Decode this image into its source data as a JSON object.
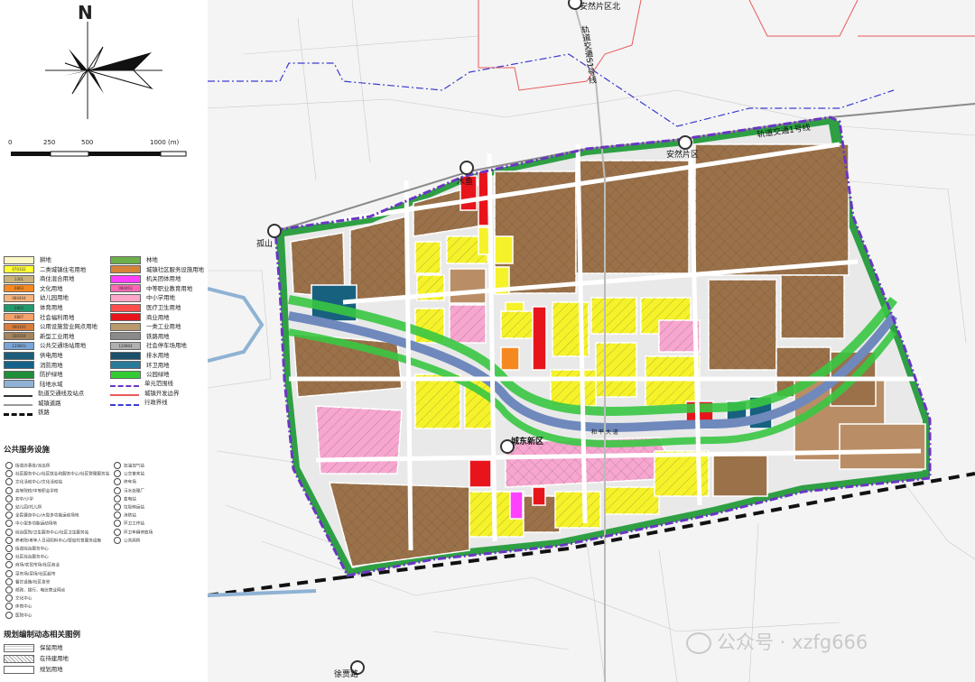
{
  "north": "N",
  "scale_labels": [
    "0",
    "250",
    "500",
    "1000",
    "(m)"
  ],
  "land_use_legend_left": [
    {
      "label": "耕地",
      "color": "#fbf8c6",
      "code": ""
    },
    {
      "label": "二类城镇住宅用地",
      "color": "#ffff33",
      "code": "070102"
    },
    {
      "label": "商住混合用地",
      "color": "#c8b27a",
      "code": "1301"
    },
    {
      "label": "文化用地",
      "color": "#f5891f",
      "code": "0803"
    },
    {
      "label": "幼儿园用地",
      "color": "#f4b37c",
      "code": "080404"
    },
    {
      "label": "体育用地",
      "color": "#1f9a6a",
      "code": "0805"
    },
    {
      "label": "社会福利用地",
      "color": "#f4a16a",
      "code": "0807"
    },
    {
      "label": "公用设施营业网点用地",
      "color": "#d97c3a",
      "code": "090105"
    },
    {
      "label": "新型工业用地",
      "color": "#a4845c",
      "code": "100104"
    },
    {
      "label": "公共交通场站用地",
      "color": "#7aa5d8",
      "code": "120803"
    },
    {
      "label": "供电用地",
      "color": "#1b5e7a",
      "code": ""
    },
    {
      "label": "消防用地",
      "color": "#14628a",
      "code": ""
    },
    {
      "label": "防护绿地",
      "color": "#1f8f3a",
      "code": ""
    },
    {
      "label": "陆地水域",
      "color": "#8fb2d4",
      "code": ""
    }
  ],
  "land_use_legend_right": [
    {
      "label": "林地",
      "color": "#6cb04a",
      "code": ""
    },
    {
      "label": "城镇社区服务设施用地",
      "color": "#d4843a",
      "code": ""
    },
    {
      "label": "机关团体用地",
      "color": "#ff40ff",
      "code": ""
    },
    {
      "label": "中等职业教育用地",
      "color": "#ff69b4",
      "code": "080403"
    },
    {
      "label": "中小学用地",
      "color": "#ffa6c9",
      "code": ""
    },
    {
      "label": "医疗卫生用地",
      "color": "#ff4d4d",
      "code": ""
    },
    {
      "label": "商业用地",
      "color": "#e8141c",
      "code": ""
    },
    {
      "label": "一类工业用地",
      "color": "#b89a6c",
      "code": ""
    },
    {
      "label": "铁路用地",
      "color": "#8a8a8a",
      "code": ""
    },
    {
      "label": "社会停车场用地",
      "color": "#b0b0b0",
      "code": "120804"
    },
    {
      "label": "排水用地",
      "color": "#1c4f6c",
      "code": ""
    },
    {
      "label": "环卫用地",
      "color": "#2a7a9a",
      "code": ""
    },
    {
      "label": "公园绿地",
      "color": "#33cc33",
      "code": ""
    }
  ],
  "line_legend_left": [
    {
      "label": "轨道交通线及站点"
    },
    {
      "label": "城镇道路"
    },
    {
      "label": "铁路"
    }
  ],
  "line_legend_right": [
    {
      "label": "单元范围线"
    },
    {
      "label": "城镇开发边界"
    },
    {
      "label": "行政界线"
    }
  ],
  "public_facilities_title": "公共服务设施",
  "public_facilities_left": [
    "街道办事处/派出所",
    "社区服务中心/社区就业和服务中心/社区管理服务站",
    "文化活动中心/文化活动站",
    "高等院校/中等职业学校",
    "初中/小学",
    "幼儿园/托儿所",
    "全民健身中心/大型多功能运动场地",
    "中小型多功能运动场地",
    "综合医院/卫生服务中心/社区卫生服务站",
    "养老院/老年人日间照料中心/婴幼托育服务设施",
    "街道综合服务中心",
    "社区综合服务中心",
    "商场/农贸市场/社区商业",
    "菜市场/菜场/社区超市",
    "餐饮设施/社区食堂",
    "邮政、银行、电信营业网点",
    "文化中心",
    "体育中心",
    "医院中心"
  ],
  "public_facilities_right": [
    "加油加气站",
    "公交首末站",
    "停车场",
    "污水处理厂",
    "变电站",
    "垃圾转运站",
    "消防站",
    "环卫工作站",
    "环卫车辆停放场",
    "公共厕所"
  ],
  "planning_status_title": "规划编制动态相关图例",
  "planning_status_items": [
    {
      "label": "保留用地",
      "pattern": "dots"
    },
    {
      "label": "在待建用地",
      "pattern": "hatch"
    },
    {
      "label": "规划用地",
      "pattern": "none"
    }
  ],
  "map_labels": {
    "rail_line_vertical": "轨道交通S1号线",
    "rail_line_top": "轨道交通1号线",
    "station_north": "安然片区北",
    "station_anran": "安然片区",
    "station_muyu": "木鱼",
    "station_gushan": "孤山",
    "station_chengdong": "城东新区",
    "station_bottom": "徐贾路",
    "avenue": "和 平 大 道"
  },
  "watermark_text": "公众号 · xzfg666",
  "colors": {
    "brown": "#9b7149",
    "brown_light": "#b98e66",
    "yellow": "#f5f22a",
    "red": "#e8141c",
    "pink": "#f7a6cf",
    "green": "#39c642",
    "dark_green": "#1f8f3a",
    "blue_river": "#7d98c6",
    "teal": "#17617f",
    "boundary": "#6a36c4",
    "road": "#ffffff"
  }
}
